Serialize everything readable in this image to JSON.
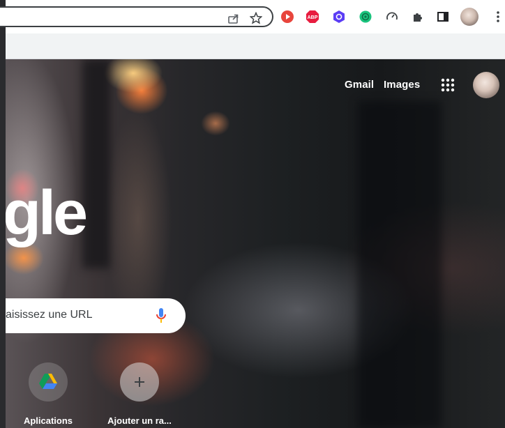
{
  "toolbar": {
    "icons": [
      "share-icon",
      "bookmark-star-icon"
    ],
    "extensions": [
      {
        "name": "youtube-ext-icon",
        "color": "#e8453c"
      },
      {
        "name": "adblock-plus-ext-icon",
        "label": "ABP",
        "color": "#e81c3f"
      },
      {
        "name": "hexagon-ext-icon",
        "color": "#5b3df5"
      },
      {
        "name": "chatgpt-ext-icon",
        "color": "#19c37d"
      },
      {
        "name": "speedometer-ext-icon",
        "color": "#3c4043"
      },
      {
        "name": "extensions-puzzle-icon",
        "color": "#3c4043"
      },
      {
        "name": "side-panel-icon",
        "color": "#3c4043"
      },
      {
        "name": "profile-avatar-icon"
      },
      {
        "name": "chrome-menu-icon",
        "color": "#3c4043"
      }
    ]
  },
  "ntp": {
    "top_links": {
      "gmail": "Gmail",
      "images": "Images"
    },
    "logo_partial": "gle",
    "search": {
      "placeholder": "aisissez une URL"
    },
    "shortcuts": [
      {
        "label": "Aplications",
        "icon": "google-drive-icon"
      },
      {
        "label": "Ajouter un ra...",
        "icon": "plus-icon"
      }
    ]
  },
  "colors": {
    "toolbar_bg": "#ffffff",
    "bookmark_bar_bg": "#f1f3f4",
    "mic_blue": "#4285f4",
    "mic_red": "#ea4335",
    "text_on_dark": "#ffffff"
  }
}
